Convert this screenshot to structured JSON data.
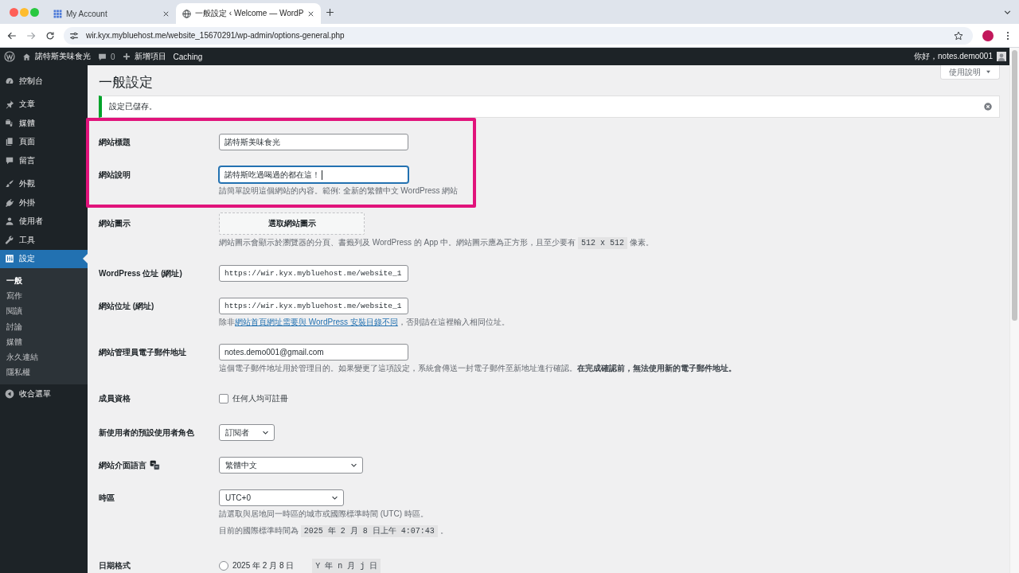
{
  "browser": {
    "tabs": [
      {
        "title": "My Account",
        "selected": false
      },
      {
        "title": "一般設定 ‹ Welcome — WordP",
        "selected": true
      }
    ],
    "url": "wir.kyx.mybluehost.me/website_15670291/wp-admin/options-general.php"
  },
  "admin_bar": {
    "site_name": "諾特斯美味食光",
    "comment_count": "0",
    "new_item": "新增項目",
    "caching": "Caching",
    "greeting": "你好，notes.demo001"
  },
  "sidebar": {
    "groups": [
      {
        "items": [
          {
            "label": "控制台",
            "selected": false
          }
        ]
      },
      {
        "items": [
          {
            "label": "文章",
            "selected": false
          },
          {
            "label": "媒體",
            "selected": false
          },
          {
            "label": "頁面",
            "selected": false
          },
          {
            "label": "留言",
            "selected": false
          }
        ]
      },
      {
        "items": [
          {
            "label": "外觀",
            "selected": false
          },
          {
            "label": "外掛",
            "selected": false
          },
          {
            "label": "使用者",
            "selected": false
          },
          {
            "label": "工具",
            "selected": false
          },
          {
            "label": "設定",
            "selected": true,
            "children": [
              {
                "label": "一般",
                "selected": true
              },
              {
                "label": "寫作",
                "selected": false
              },
              {
                "label": "閱讀",
                "selected": false
              },
              {
                "label": "討論",
                "selected": false
              },
              {
                "label": "媒體",
                "selected": false
              },
              {
                "label": "永久連結",
                "selected": false
              },
              {
                "label": "隱私權",
                "selected": false
              }
            ]
          }
        ]
      }
    ],
    "collapse": "收合選單"
  },
  "page": {
    "title": "一般設定",
    "help_tab": "使用說明",
    "notice": "設定已儲存。"
  },
  "form": {
    "rows": [
      {
        "kind": "text",
        "label": "網站標題",
        "value": "諾特斯美味食光",
        "focused": false,
        "highlighted": true
      },
      {
        "kind": "text",
        "label": "網站說明",
        "value": "諾特斯吃過喝過的都在這！",
        "focused": true,
        "highlighted": true,
        "description": [
          [
            {
              "kind": "text",
              "text": "請簡單說明這個網站的內容。範例: 全新的繁體中文 WordPress 網站"
            }
          ]
        ]
      },
      {
        "kind": "icon_picker",
        "label": "網站圖示",
        "button": "選取網站圖示",
        "highlighted": false,
        "description": [
          [
            {
              "kind": "text",
              "text": "網站圖示會顯示於瀏覽器的分頁、書籤列及 WordPress 的 App 中。網站圖示應為正方形，且至少要有 "
            },
            {
              "kind": "code",
              "text": "512 x 512"
            },
            {
              "kind": "text",
              "text": " 像素。"
            }
          ]
        ]
      },
      {
        "kind": "url",
        "label": "WordPress 位址 (網址)",
        "value": "https://wir.kyx.mybluehost.me/website_1",
        "focused": false,
        "highlighted": false
      },
      {
        "kind": "url",
        "label": "網站位址 (網址)",
        "value": "https://wir.kyx.mybluehost.me/website_1",
        "focused": false,
        "highlighted": false,
        "description": [
          [
            {
              "kind": "text",
              "text": "除非"
            },
            {
              "kind": "link",
              "text": "網站首頁網址需要與 WordPress 安裝目錄不同"
            },
            {
              "kind": "text",
              "text": "，否則請在這裡輸入相同位址。"
            }
          ]
        ]
      },
      {
        "kind": "email",
        "label": "網站管理員電子郵件地址",
        "value": "notes.demo001@gmail.com",
        "focused": false,
        "highlighted": false,
        "description": [
          [
            {
              "kind": "text",
              "text": "這個電子郵件地址用於管理目的。如果變更了這項設定，系統會傳送一封電子郵件至新地址進行確認。**在完成確認前，無法使用新的電子郵件地址。**"
            }
          ]
        ]
      },
      {
        "kind": "checkbox",
        "label": "成員資格",
        "option": "任何人均可註冊",
        "checked": false,
        "highlighted": false
      },
      {
        "kind": "role_select",
        "label": "新使用者的預設使用者角色",
        "value": "訂閱者",
        "highlighted": false
      },
      {
        "kind": "language_select",
        "label": "網站介面語言",
        "value": "繁體中文",
        "highlighted": false
      },
      {
        "kind": "timezone_select",
        "label": "時區",
        "value": "UTC+0",
        "highlighted": false,
        "description": [
          [
            {
              "kind": "text",
              "text": "請選取與居地同一時區的城市或國際標準時間 (UTC) 時區。"
            }
          ],
          [
            {
              "kind": "text",
              "text": "目前的國際標準時間為 "
            },
            {
              "kind": "code",
              "text": "2025 年 2 月 8 日上午 4:07:43"
            },
            {
              "kind": "text",
              "text": " 。"
            }
          ]
        ]
      },
      {
        "kind": "radio",
        "label": "日期格式",
        "highlighted": false,
        "options": [
          {
            "label": "2025 年 2 月 8 日",
            "format": "Y 年 n 月 j 日",
            "selected": false
          }
        ]
      }
    ]
  }
}
